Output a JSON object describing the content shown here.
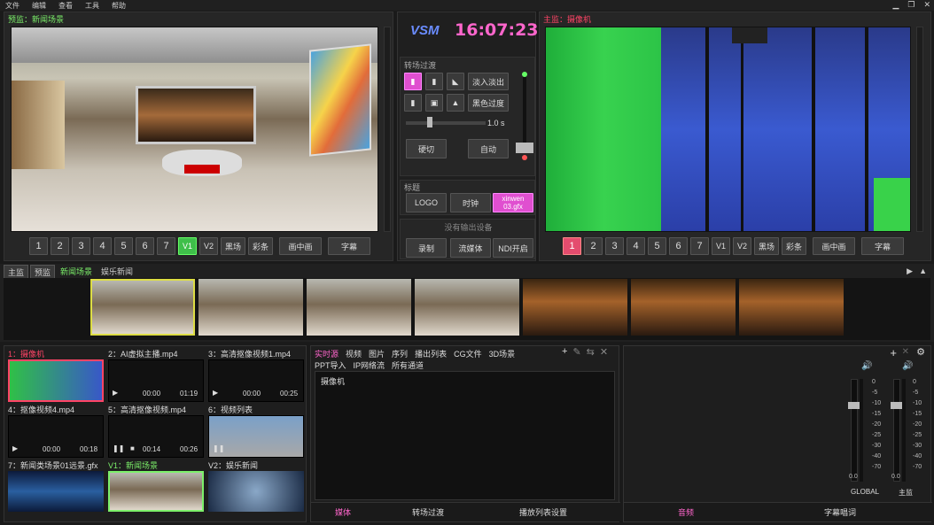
{
  "menu": [
    "文件",
    "编辑",
    "查看",
    "工具",
    "帮助"
  ],
  "window_controls": [
    "▁",
    "❐",
    "✕"
  ],
  "preview": {
    "label": "预监：新闻场景"
  },
  "program": {
    "label": "主监：摄像机"
  },
  "brand": {
    "name": "VSM",
    "clock": "16:07:23"
  },
  "preview_buttons": [
    "1",
    "2",
    "3",
    "4",
    "5",
    "6",
    "7",
    "V1",
    "V2",
    "黑场",
    "彩条",
    "画中画",
    "字幕"
  ],
  "program_buttons": [
    "1",
    "2",
    "3",
    "4",
    "5",
    "6",
    "7",
    "V1",
    "V2",
    "黑场",
    "彩条",
    "画中画",
    "字幕"
  ],
  "transition": {
    "title": "转场过渡",
    "fade_in_out": "淡入淡出",
    "fade_black": "黑色过度",
    "duration": "1.0 s",
    "cut": "硬切",
    "auto": "自动"
  },
  "title_section": {
    "title": "标题",
    "logo": "LOGO",
    "clock": "时钟",
    "gfx": "xinwen\n03.gfx"
  },
  "output": {
    "title": "没有输出设备",
    "record": "录制",
    "stream": "流媒体",
    "ndi": "NDI开启"
  },
  "scene_tabs": [
    "主监",
    "预监",
    "新闻场景",
    "娱乐新闻"
  ],
  "sources": [
    {
      "label": "1：摄像机",
      "time_a": "",
      "time_b": ""
    },
    {
      "label": "2：AI虚拟主播.mp4",
      "time_a": "00:00",
      "time_b": "01:19"
    },
    {
      "label": "3：高清抠像视频1.mp4",
      "time_a": "00:00",
      "time_b": "00:25"
    },
    {
      "label": "4：抠像视频4.mp4",
      "time_a": "00:00",
      "time_b": "00:18"
    },
    {
      "label": "5：高清抠像视频.mp4",
      "time_a": "00:14",
      "time_b": "00:26"
    },
    {
      "label": "6：视频列表",
      "time_a": "",
      "time_b": ""
    },
    {
      "label": "7：新闻类场景01远景.gfx",
      "time_a": "",
      "time_b": ""
    },
    {
      "label": "V1：新闻场景",
      "time_a": "",
      "time_b": ""
    },
    {
      "label": "V2：娱乐新闻",
      "time_a": "",
      "time_b": ""
    }
  ],
  "media_tabs": [
    "实时源",
    "视频",
    "图片",
    "序列",
    "播出列表",
    "CG文件",
    "3D场景",
    "PPT导入",
    "IP网络流",
    "所有通道"
  ],
  "media_list_item": "摄像机",
  "bottom_tabs_mid": [
    "媒体",
    "转场过渡",
    "播放列表设置"
  ],
  "audio": {
    "scale": [
      "0",
      "-5",
      "-10",
      "-15",
      "-20",
      "-25",
      "-30",
      "-40",
      "-70"
    ],
    "master_value": "0.0",
    "global_value": "0.0",
    "global_label": "GLOBAL",
    "main_label": "主监"
  },
  "bottom_tabs_right": [
    "音频",
    "字幕唱词"
  ],
  "colors": {
    "accent_green": "#7cf06a",
    "accent_red": "#ff4466",
    "accent_pink": "#e04fd0",
    "clock": "#ff66cc"
  }
}
